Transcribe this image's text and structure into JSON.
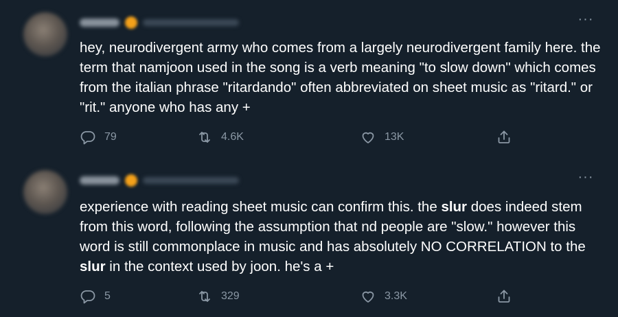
{
  "tweets": [
    {
      "more_label": "···",
      "text_parts": [
        "hey, neurodivergent army who comes from a largely neurodivergent family here. the term that namjoon used in the song is a verb meaning \"to slow down\" which comes from the italian phrase \"ritardando\" often abbreviated on sheet music as \"ritard.\" or \"rit.\" anyone who has any +"
      ],
      "stats": {
        "replies": "79",
        "retweets": "4.6K",
        "likes": "13K"
      }
    },
    {
      "more_label": "···",
      "text_parts": [
        "experience with reading sheet music can confirm this. the ",
        "slur",
        " does indeed stem from this word, following the assumption that nd people are \"slow.\" however this word is still commonplace in music and has absolutely NO CORRELATION to the ",
        "slur",
        " in the context used by joon. he's a +"
      ],
      "stats": {
        "replies": "5",
        "retweets": "329",
        "likes": "3.3K"
      }
    }
  ],
  "icons": {
    "reply": "reply-icon",
    "retweet": "retweet-icon",
    "like": "heart-icon",
    "share": "share-icon",
    "more": "more-options-icon"
  },
  "colors": {
    "background": "#15202b",
    "text": "#ffffff",
    "muted": "#8b98a5"
  }
}
